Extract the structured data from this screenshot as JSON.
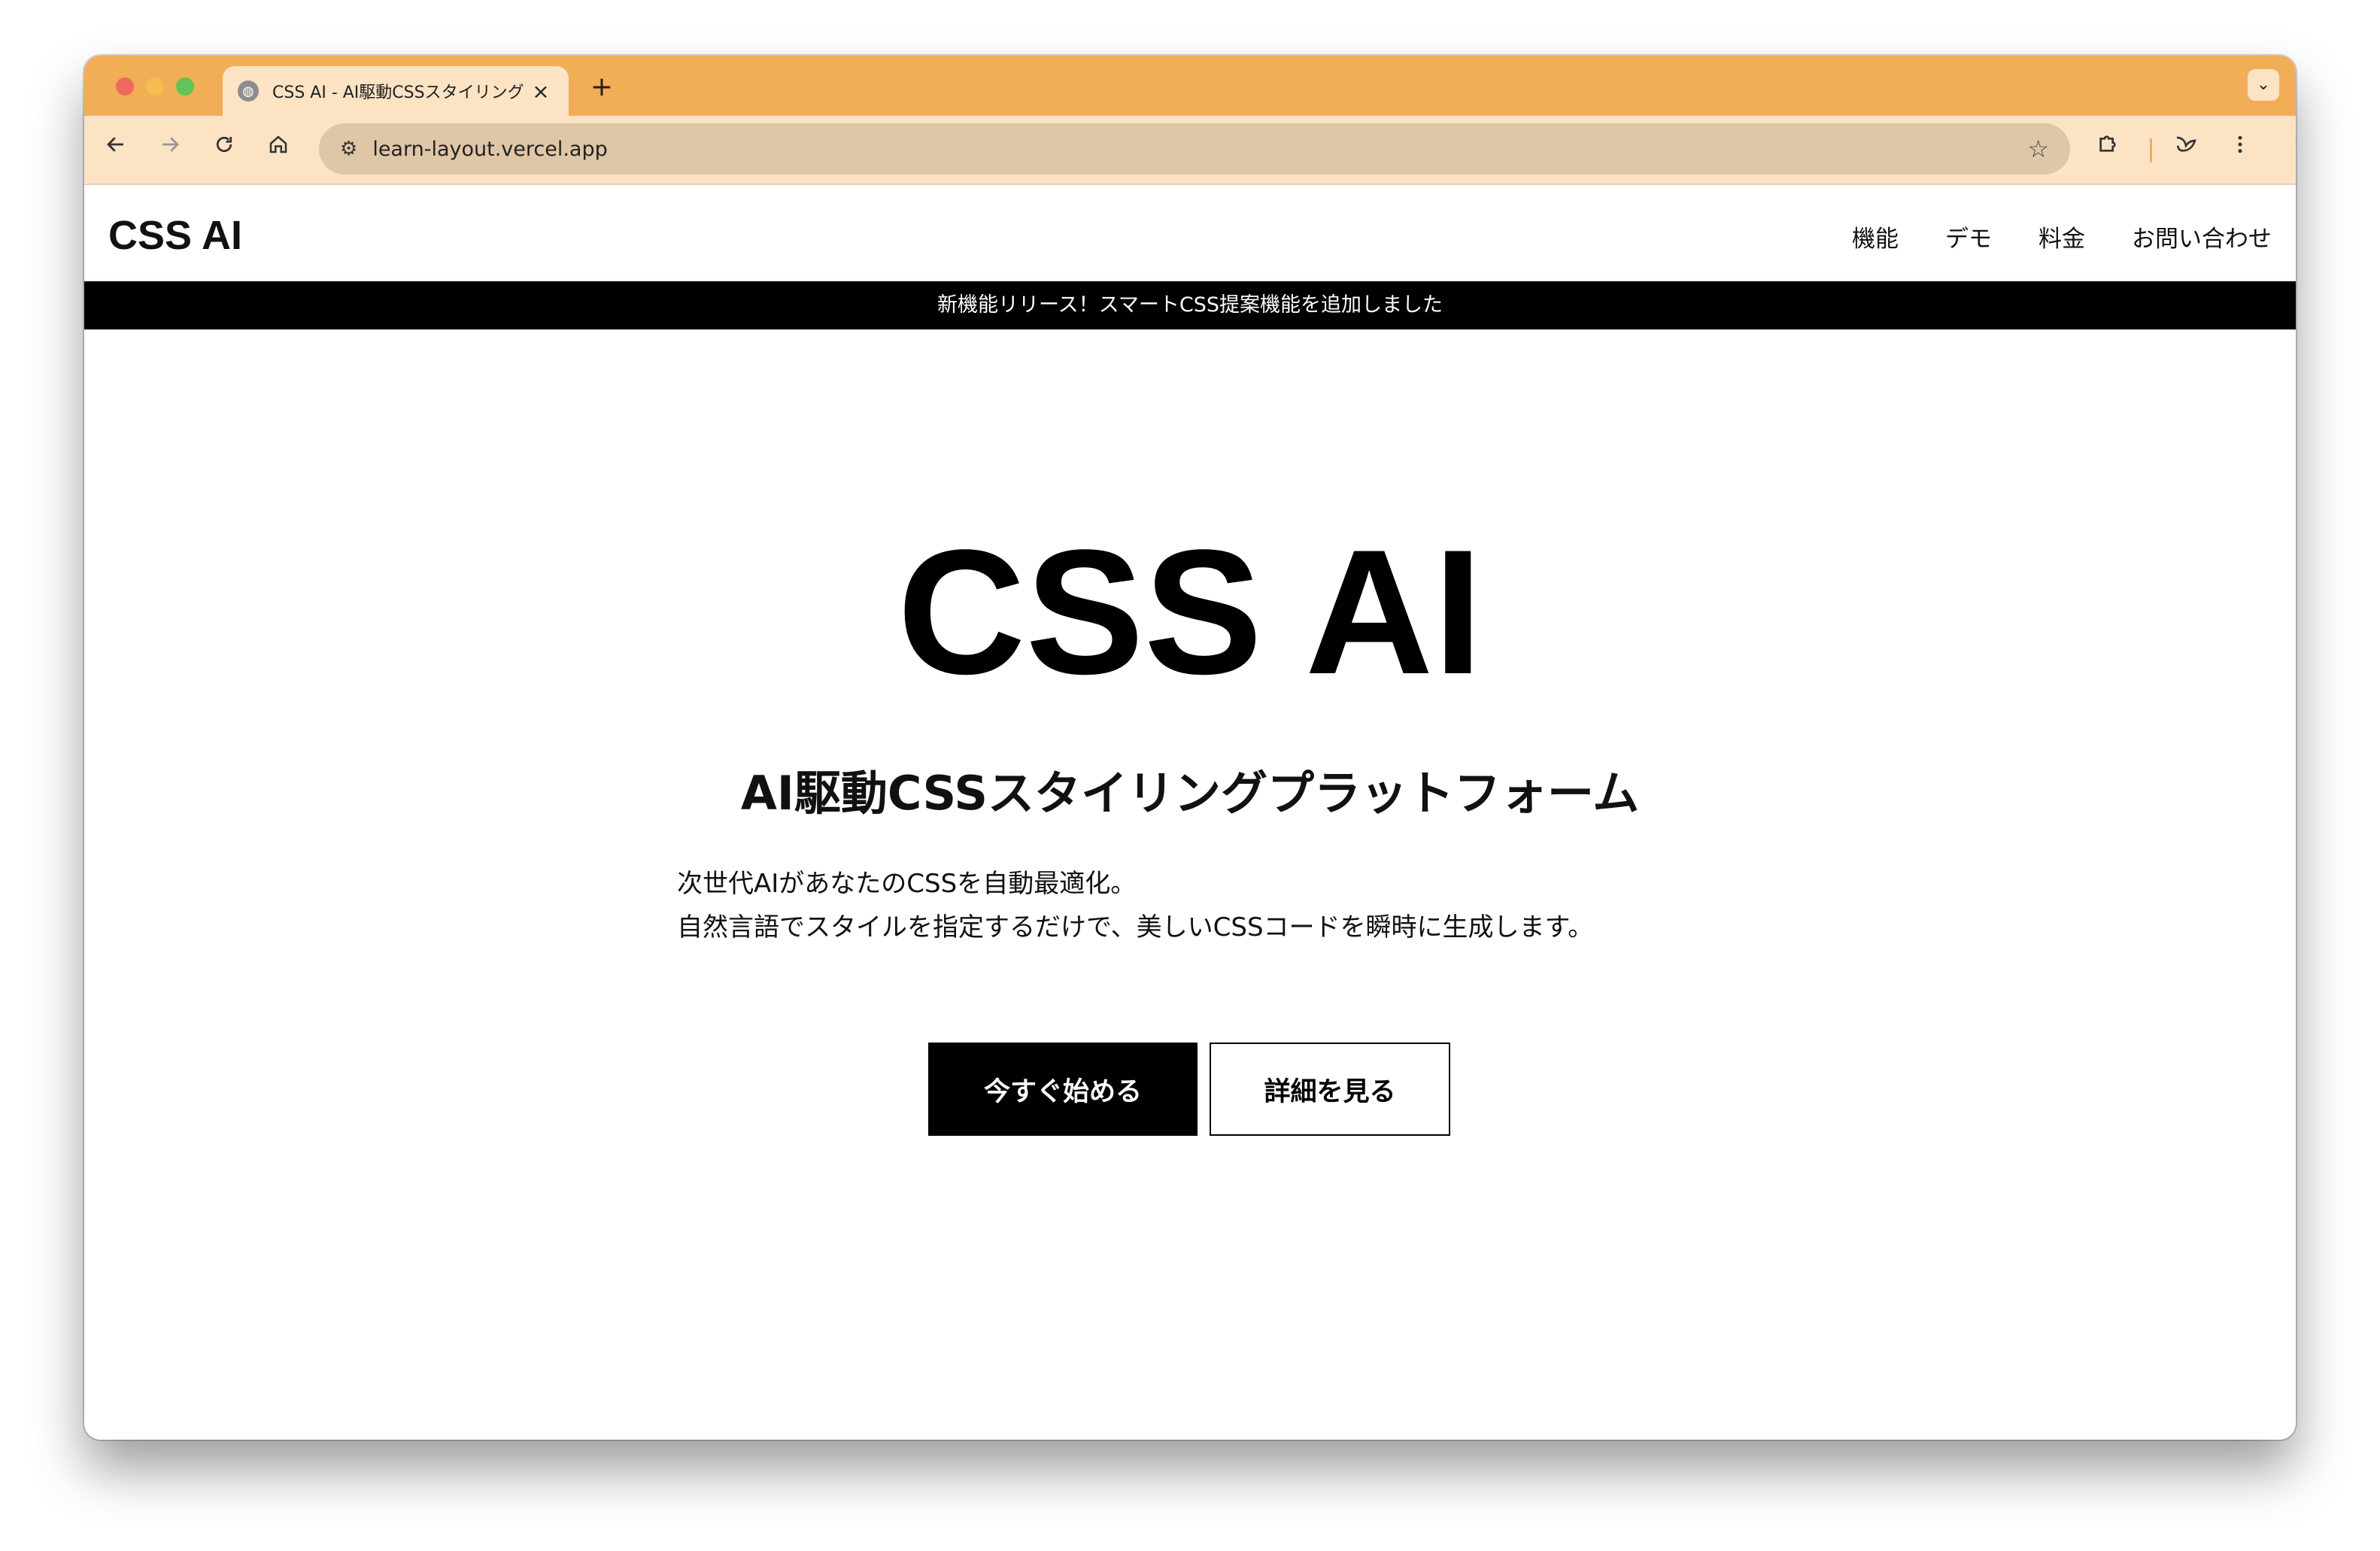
{
  "browser": {
    "tab": {
      "title": "CSS AI - AI駆動CSSスタイリング"
    },
    "url": "learn-layout.vercel.app",
    "icons": {
      "back": "arrow-left-icon",
      "forward": "arrow-right-icon",
      "reload": "reload-icon",
      "home": "home-icon",
      "site_info": "tune-icon",
      "bookmark": "star-icon",
      "extensions": "puzzle-icon",
      "profile": "bird-icon",
      "menu": "kebab-menu-icon"
    },
    "colors": {
      "frame": "#f2ad57",
      "toolbar": "#fce3c4",
      "omnibox": "#dfc6a6"
    }
  },
  "site": {
    "logo": "CSS AI",
    "nav": [
      {
        "label": "機能"
      },
      {
        "label": "デモ"
      },
      {
        "label": "料金"
      },
      {
        "label": "お問い合わせ"
      }
    ],
    "banner": "新機能リリース！スマートCSS提案機能を追加しました"
  },
  "hero": {
    "title": "CSS AI",
    "subtitle": "AI駆動CSSスタイリングプラットフォーム",
    "description": [
      "次世代AIがあなたのCSSを自動最適化。",
      "自然言語でスタイルを指定するだけで、美しいCSSコードを瞬時に生成します。"
    ],
    "primary_button": "今すぐ始める",
    "secondary_button": "詳細を見る"
  }
}
